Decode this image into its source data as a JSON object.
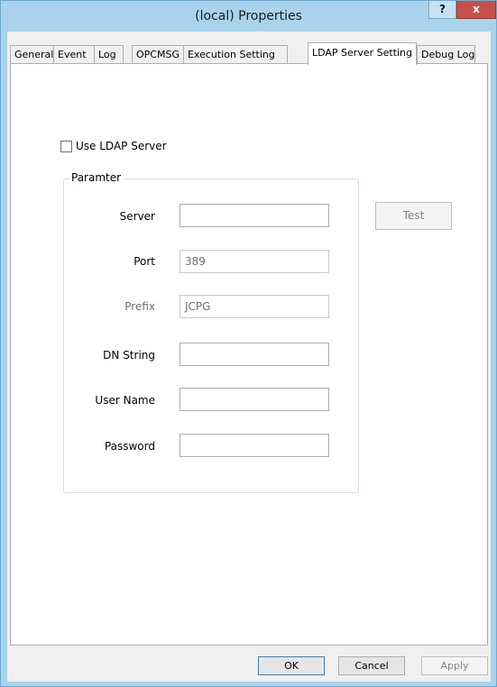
{
  "window": {
    "title": "(local) Properties",
    "help_label": "?",
    "close_label": "x"
  },
  "tabs": [
    {
      "label": "General"
    },
    {
      "label": "Event"
    },
    {
      "label": "Log"
    },
    {
      "label": "OPCMSG"
    },
    {
      "label": "Execution Setting"
    },
    {
      "label": "LDAP Server Setting",
      "active": true
    },
    {
      "label": "Debug Log"
    }
  ],
  "ldap": {
    "use_ldap_label": "Use LDAP Server",
    "use_ldap_checked": false,
    "group_title": "Paramter",
    "fields": {
      "server": {
        "label": "Server",
        "value": ""
      },
      "port": {
        "label": "Port",
        "value": "389"
      },
      "prefix": {
        "label": "Prefix",
        "value": "JCPG"
      },
      "dn_string": {
        "label": "DN String",
        "value": ""
      },
      "user_name": {
        "label": "User Name",
        "value": ""
      },
      "password": {
        "label": "Password",
        "value": ""
      }
    },
    "test_label": "Test"
  },
  "buttons": {
    "ok": "OK",
    "cancel": "Cancel",
    "apply": "Apply"
  }
}
